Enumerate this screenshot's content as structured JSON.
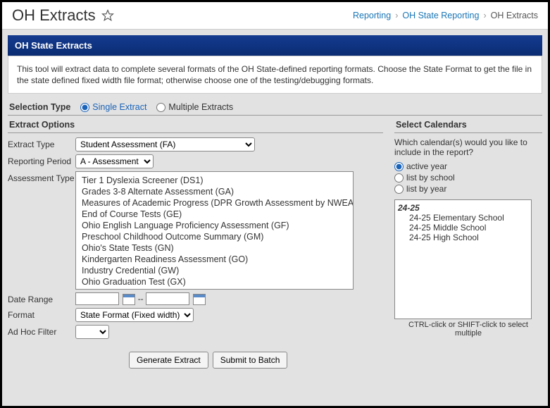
{
  "header": {
    "title": "OH Extracts",
    "breadcrumb": {
      "items": [
        "Reporting",
        "OH State Reporting"
      ],
      "current": "OH Extracts"
    }
  },
  "band": {
    "title": "OH State Extracts"
  },
  "info": {
    "text": "This tool will extract data to complete several formats of the OH State-defined reporting formats. Choose the State Format to get the file in the state defined fixed width file format; otherwise choose one of the testing/debugging formats."
  },
  "selection_type": {
    "label": "Selection Type",
    "options": {
      "single": "Single Extract",
      "multiple": "Multiple Extracts"
    },
    "selected": "single"
  },
  "extract_options": {
    "title": "Extract Options",
    "extract_type": {
      "label": "Extract Type",
      "value": "Student Assessment (FA)"
    },
    "reporting_period": {
      "label": "Reporting Period",
      "value": "A - Assessment"
    },
    "assessment_type": {
      "label": "Assessment Type",
      "options": [
        "Tier 1 Dyslexia Screener (DS1)",
        "Grades 3-8 Alternate Assessment (GA)",
        "Measures of Academic Progress (DPR Growth Assessment by NWEA only) (GD)",
        "End of Course Tests (GE)",
        "Ohio English Language Proficiency Assessment (GF)",
        "Preschool Childhood Outcome Summary (GM)",
        "Ohio's State Tests (GN)",
        "Kindergarten Readiness Assessment (GO)",
        "Industry Credential (GW)",
        "Ohio Graduation Test (GX)"
      ]
    },
    "date_range": {
      "label": "Date Range",
      "sep": "--"
    },
    "format": {
      "label": "Format",
      "value": "State Format (Fixed width)"
    },
    "adhoc": {
      "label": "Ad Hoc Filter",
      "value": ""
    }
  },
  "calendars": {
    "title": "Select Calendars",
    "question": "Which calendar(s) would you like to include in the report?",
    "modes": {
      "active": "active year",
      "school": "list by school",
      "year": "list by year"
    },
    "selected_mode": "active",
    "group": "24-25",
    "items": [
      "24-25 Elementary School",
      "24-25 Middle School",
      "24-25 High School"
    ],
    "hint": "CTRL-click or SHIFT-click to select multiple"
  },
  "buttons": {
    "generate": "Generate Extract",
    "submit": "Submit to Batch"
  }
}
